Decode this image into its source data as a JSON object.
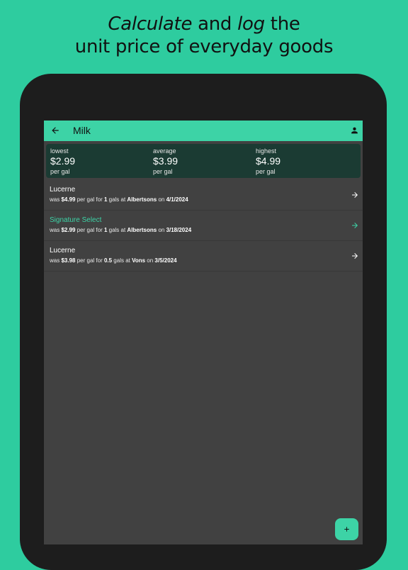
{
  "headline": {
    "line1_part1": "Calculate",
    "line1_part2": " and ",
    "line1_part3": "log",
    "line1_part4": " the",
    "line2": "unit price of everyday goods"
  },
  "appbar": {
    "title": "Milk",
    "back_icon": "arrow-left-icon",
    "account_icon": "person-icon"
  },
  "stats": {
    "lowest": {
      "label": "lowest",
      "value": "$2.99",
      "unit": "per gal"
    },
    "average": {
      "label": "average",
      "value": "$3.99",
      "unit": "per gal"
    },
    "highest": {
      "label": "highest",
      "value": "$4.99",
      "unit": "per gal"
    }
  },
  "entries": [
    {
      "name": "Lucerne",
      "w1": "was ",
      "price": "$4.99",
      "w2": " per gal for ",
      "qty": "1",
      "w3": " gals at ",
      "store": "Albertsons",
      "w4": " on ",
      "date": "4/1/2024"
    },
    {
      "name": "Signature Select",
      "w1": "was ",
      "price": "$2.99",
      "w2": " per gal for ",
      "qty": "1",
      "w3": " gals at ",
      "store": "Albertsons",
      "w4": " on ",
      "date": "3/18/2024"
    },
    {
      "name": "Lucerne",
      "w1": "was ",
      "price": "$3.98",
      "w2": " per gal for ",
      "qty": "0.5",
      "w3": " gals at ",
      "store": "Vons",
      "w4": " on ",
      "date": "3/5/2024"
    }
  ],
  "fab": {
    "icon": "plus-icon"
  },
  "colors": {
    "background": "#2ecc9f",
    "accent": "#3dd3a6",
    "stats_panel": "#1b3b33",
    "list_background": "#414141"
  }
}
